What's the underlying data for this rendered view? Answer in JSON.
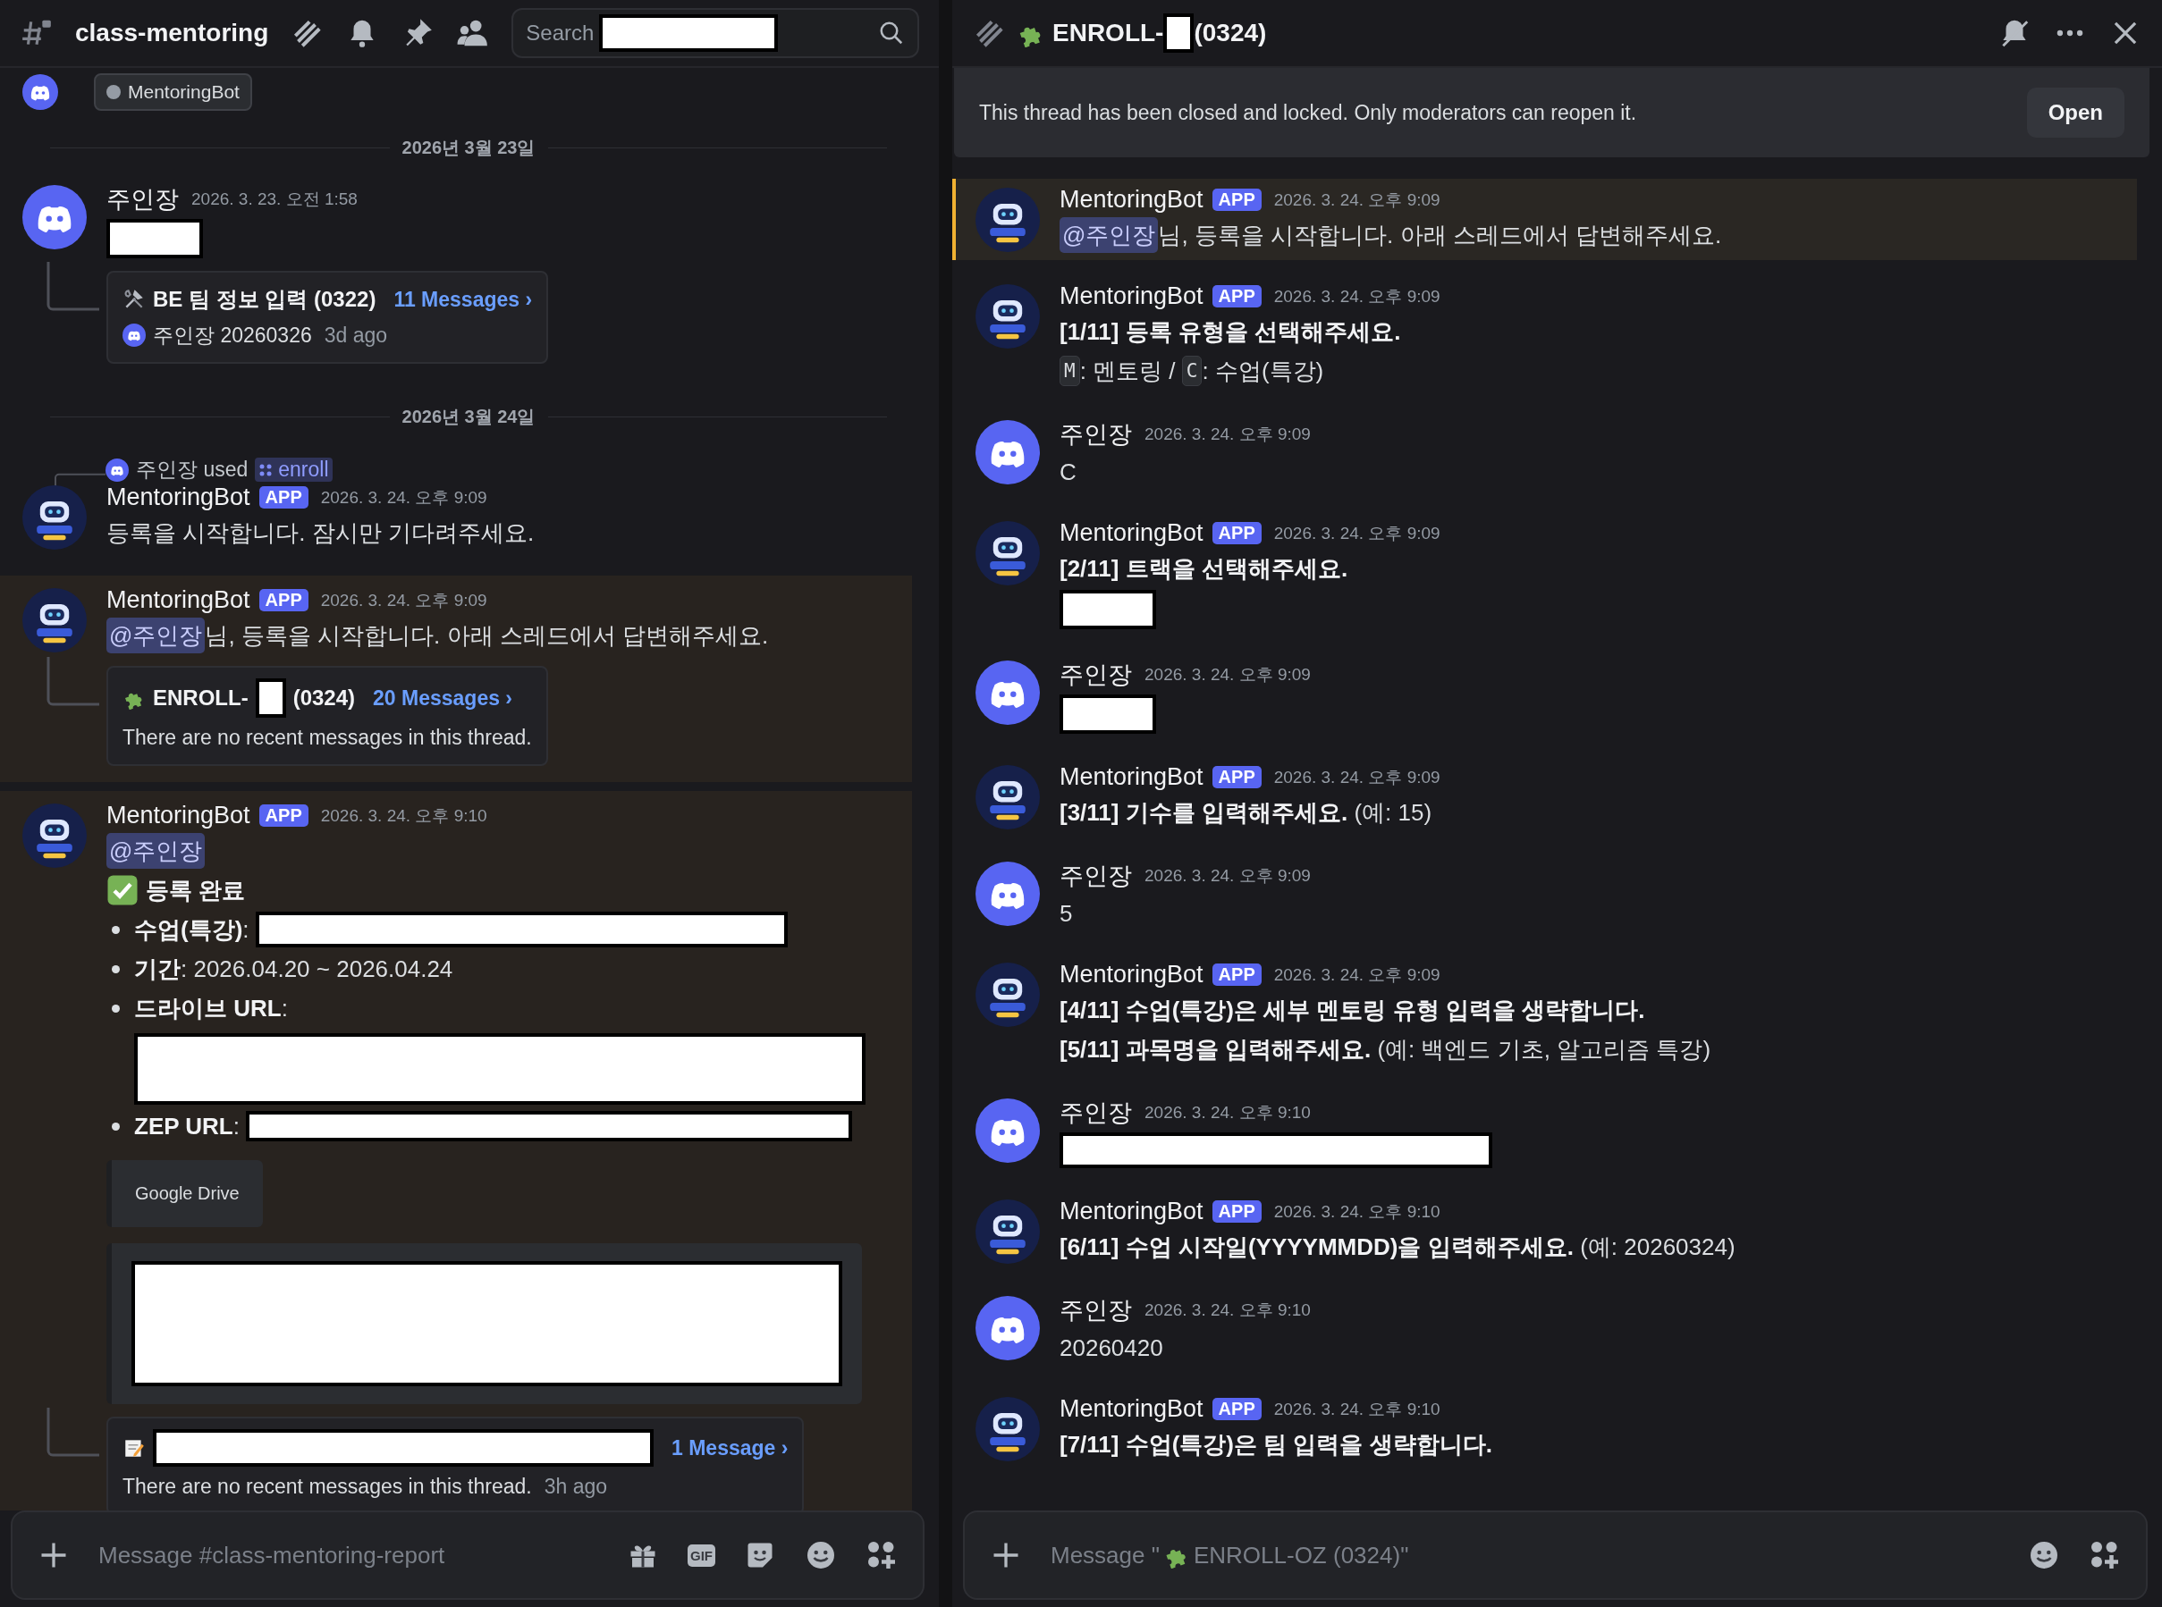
{
  "left": {
    "header": {
      "channel": "class-mentoring",
      "search": {
        "placeholder": "Search"
      }
    },
    "items": [
      {
        "kind": "partial",
        "chip": "MentoringBot"
      },
      {
        "kind": "date",
        "text": "2026년 3월 23일"
      },
      {
        "kind": "message",
        "author": "주인장",
        "time": "2026. 3. 23. 오전 1:58",
        "highlighted": false,
        "blocks": [
          {
            "kind": "line",
            "segments": [
              {
                "kind": "blank"
              }
            ]
          },
          {
            "kind": "toolthread",
            "title": [
              {
                "kind": "bold",
                "text": "BE 팀 정보 입력 (0322)"
              }
            ],
            "link": "11 Messages ›",
            "preview_avatar": true,
            "preview": "주인장 20260326",
            "age": "3d ago"
          }
        ]
      },
      {
        "kind": "date",
        "text": "2026년 3월 24일"
      },
      {
        "kind": "message",
        "author": "MentoringBot",
        "badge": "APP",
        "time": "2026. 3. 24. 오후 9:09",
        "highlighted": false,
        "reply": {
          "user": "주인장",
          "verb": "used",
          "command": "enroll"
        },
        "blocks": [
          {
            "kind": "line",
            "segments": [
              {
                "kind": "text",
                "text": "등록을 시작합니다. 잠시만 기다려주세요."
              }
            ]
          }
        ]
      },
      {
        "kind": "message",
        "author": "MentoringBot",
        "badge": "APP",
        "time": "2026. 3. 24. 오후 9:09",
        "highlighted": true,
        "blocks": [
          {
            "kind": "line",
            "segments": [
              {
                "kind": "mention",
                "text": "@주인장"
              },
              {
                "kind": "text",
                "text": "님, 등록을 시작합니다. 아래 스레드에서 답변해주세요."
              }
            ]
          },
          {
            "kind": "puzzlethread",
            "title": [
              {
                "kind": "bold",
                "text": "ENROLL-"
              },
              {
                "kind": "tinyblank"
              },
              {
                "kind": "bold",
                "text": "(0324)"
              }
            ],
            "link": "20 Messages ›",
            "preview_avatar": false,
            "preview": "There are no recent messages in this thread."
          }
        ]
      },
      {
        "kind": "message",
        "author": "MentoringBot",
        "badge": "APP",
        "time": "2026. 3. 24. 오후 9:10",
        "highlighted": true,
        "blocks": [
          {
            "kind": "line",
            "segments": [
              {
                "kind": "mention",
                "text": "@주인장"
              }
            ]
          },
          {
            "kind": "line",
            "segments": [
              {
                "kind": "checkmark"
              },
              {
                "kind": "bold",
                "text": "등록 완료"
              }
            ]
          },
          {
            "kind": "bullet",
            "segments": [
              {
                "kind": "bold",
                "text": "수업(특강)"
              },
              {
                "kind": "text",
                "text": ": "
              },
              {
                "kind": "longblank"
              }
            ]
          },
          {
            "kind": "bullet",
            "segments": [
              {
                "kind": "bold",
                "text": "기간"
              },
              {
                "kind": "text",
                "text": ": 2026.04.20 ~ 2026.04.24"
              }
            ]
          },
          {
            "kind": "bullet",
            "segments": [
              {
                "kind": "bold",
                "text": "드라이브 URL"
              },
              {
                "kind": "text",
                "text": ":"
              }
            ],
            "below": [
              {
                "kind": "tallblank"
              }
            ]
          },
          {
            "kind": "bullet",
            "segments": [
              {
                "kind": "bold",
                "text": "ZEP URL"
              },
              {
                "kind": "text",
                "text": ": "
              },
              {
                "kind": "urlblank"
              }
            ]
          },
          {
            "kind": "embed",
            "segments": [
              {
                "kind": "text",
                "text": "Google Drive"
              }
            ]
          },
          {
            "kind": "embed",
            "segments": [
              {
                "kind": "imageblank"
              }
            ]
          },
          {
            "kind": "memothread",
            "title": [
              {
                "kind": "titleblank"
              }
            ],
            "link": "1 Message ›",
            "preview_avatar": false,
            "preview": "There are no recent messages in this thread.",
            "age": "3h ago"
          }
        ]
      }
    ],
    "composer": {
      "placeholder": "Message #class-mentoring-report",
      "gif": "GIF"
    }
  },
  "right": {
    "header": {
      "title": [
        {
          "kind": "text",
          "text": "ENROLL-"
        },
        {
          "kind": "tinyblank"
        },
        {
          "kind": "text",
          "text": "(0324)"
        }
      ]
    },
    "banner": {
      "text": "This thread has been closed and locked. Only moderators can reopen it.",
      "button": "Open"
    },
    "items": [
      {
        "kind": "message",
        "author": "MentoringBot",
        "badge": "APP",
        "time": "2026. 3. 24. 오후 9:09",
        "highlighted": true,
        "blocks": [
          {
            "kind": "line",
            "segments": [
              {
                "kind": "mention",
                "text": "@주인장"
              },
              {
                "kind": "text",
                "text": "님, 등록을 시작합니다. 아래 스레드에서 답변해주세요."
              }
            ]
          }
        ]
      },
      {
        "kind": "message",
        "author": "MentoringBot",
        "badge": "APP",
        "time": "2026. 3. 24. 오후 9:09",
        "highlighted": false,
        "blocks": [
          {
            "kind": "line",
            "segments": [
              {
                "kind": "bold",
                "text": "[1/11] 등록 유형을 선택해주세요."
              }
            ]
          },
          {
            "kind": "line",
            "segments": [
              {
                "kind": "code",
                "text": "M"
              },
              {
                "kind": "text",
                "text": ": 멘토링 / "
              },
              {
                "kind": "code",
                "text": "C"
              },
              {
                "kind": "text",
                "text": ": 수업(특강)"
              }
            ]
          }
        ]
      },
      {
        "kind": "message",
        "author": "주인장",
        "time": "2026. 3. 24. 오후 9:09",
        "highlighted": false,
        "blocks": [
          {
            "kind": "line",
            "segments": [
              {
                "kind": "text",
                "text": "C"
              }
            ]
          }
        ]
      },
      {
        "kind": "message",
        "author": "MentoringBot",
        "badge": "APP",
        "time": "2026. 3. 24. 오후 9:09",
        "highlighted": false,
        "blocks": [
          {
            "kind": "line",
            "segments": [
              {
                "kind": "bold",
                "text": "[2/11] 트랙을 선택해주세요."
              }
            ]
          },
          {
            "kind": "line",
            "segments": [
              {
                "kind": "blank"
              }
            ]
          }
        ]
      },
      {
        "kind": "message",
        "author": "주인장",
        "time": "2026. 3. 24. 오후 9:09",
        "highlighted": false,
        "blocks": [
          {
            "kind": "line",
            "segments": [
              {
                "kind": "blank"
              }
            ]
          }
        ]
      },
      {
        "kind": "message",
        "author": "MentoringBot",
        "badge": "APP",
        "time": "2026. 3. 24. 오후 9:09",
        "highlighted": false,
        "blocks": [
          {
            "kind": "line",
            "segments": [
              {
                "kind": "bold",
                "text": "[3/11] 기수를 입력해주세요."
              },
              {
                "kind": "text",
                "text": " (예: 15)"
              }
            ]
          }
        ]
      },
      {
        "kind": "message",
        "author": "주인장",
        "time": "2026. 3. 24. 오후 9:09",
        "highlighted": false,
        "blocks": [
          {
            "kind": "line",
            "segments": [
              {
                "kind": "text",
                "text": "5"
              }
            ]
          }
        ]
      },
      {
        "kind": "message",
        "author": "MentoringBot",
        "badge": "APP",
        "time": "2026. 3. 24. 오후 9:09",
        "highlighted": false,
        "blocks": [
          {
            "kind": "line",
            "segments": [
              {
                "kind": "bold",
                "text": "[4/11] 수업(특강)은 세부 멘토링 유형 입력을 생략합니다."
              }
            ]
          },
          {
            "kind": "line",
            "segments": [
              {
                "kind": "bold",
                "text": "[5/11] 과목명을 입력해주세요."
              },
              {
                "kind": "text",
                "text": " (예: 백엔드 기초, 알고리즘 특강)"
              }
            ]
          }
        ]
      },
      {
        "kind": "message",
        "author": "주인장",
        "time": "2026. 3. 24. 오후 9:10",
        "highlighted": false,
        "blocks": [
          {
            "kind": "line",
            "segments": [
              {
                "kind": "mediumblank"
              }
            ]
          }
        ]
      },
      {
        "kind": "message",
        "author": "MentoringBot",
        "badge": "APP",
        "time": "2026. 3. 24. 오후 9:10",
        "highlighted": false,
        "blocks": [
          {
            "kind": "line",
            "segments": [
              {
                "kind": "bold",
                "text": "[6/11] 수업 시작일(YYYYMMDD)을 입력해주세요."
              },
              {
                "kind": "text",
                "text": " (예: 20260324)"
              }
            ]
          }
        ]
      },
      {
        "kind": "message",
        "author": "주인장",
        "time": "2026. 3. 24. 오후 9:10",
        "highlighted": false,
        "blocks": [
          {
            "kind": "line",
            "segments": [
              {
                "kind": "text",
                "text": "20260420"
              }
            ]
          }
        ]
      },
      {
        "kind": "message",
        "author": "MentoringBot",
        "badge": "APP",
        "time": "2026. 3. 24. 오후 9:10",
        "highlighted": false,
        "blocks": [
          {
            "kind": "line",
            "segments": [
              {
                "kind": "bold",
                "text": "[7/11] 수업(특강)은 팀 입력을 생략합니다."
              }
            ]
          }
        ]
      }
    ],
    "composer": {
      "placeholder_before": "Message \"",
      "placeholder_after": "ENROLL-OZ (0324)\""
    }
  }
}
